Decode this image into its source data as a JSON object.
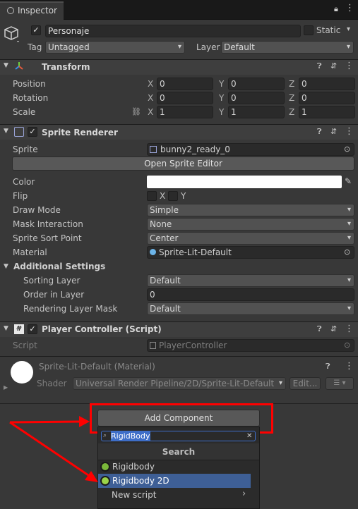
{
  "tab": {
    "title": "Inspector"
  },
  "gameobject": {
    "name": "Personaje",
    "static_label": "Static",
    "tag_label": "Tag",
    "tag_value": "Untagged",
    "layer_label": "Layer",
    "layer_value": "Default"
  },
  "transform": {
    "title": "Transform",
    "position_label": "Position",
    "rotation_label": "Rotation",
    "scale_label": "Scale",
    "x": "X",
    "y": "Y",
    "z": "Z",
    "position": [
      "0",
      "0",
      "0"
    ],
    "rotation": [
      "0",
      "0",
      "0"
    ],
    "scale": [
      "1",
      "1",
      "1"
    ]
  },
  "sprite_renderer": {
    "title": "Sprite Renderer",
    "sprite_label": "Sprite",
    "sprite_value": "bunny2_ready_0",
    "open_editor": "Open Sprite Editor",
    "color_label": "Color",
    "flip_label": "Flip",
    "flip_x": "X",
    "flip_y": "Y",
    "draw_mode_label": "Draw Mode",
    "draw_mode": "Simple",
    "mask_label": "Mask Interaction",
    "mask": "None",
    "sort_point_label": "Sprite Sort Point",
    "sort_point": "Center",
    "material_label": "Material",
    "material": "Sprite-Lit-Default",
    "additional_label": "Additional Settings",
    "sorting_layer_label": "Sorting Layer",
    "sorting_layer": "Default",
    "order_label": "Order in Layer",
    "order": "0",
    "rlm_label": "Rendering Layer Mask",
    "rlm": "Default"
  },
  "player_controller": {
    "title": "Player Controller (Script)",
    "script_label": "Script",
    "script_value": "PlayerController"
  },
  "material": {
    "title": "Sprite-Lit-Default (Material)",
    "shader_label": "Shader",
    "shader_value": "Universal Render Pipeline/2D/Sprite-Lit-Default",
    "edit_label": "Edit..."
  },
  "add_component": {
    "label": "Add Component"
  },
  "popup": {
    "search_value": "RigidBody",
    "search_header": "Search",
    "items": [
      "Rigidbody",
      "Rigidbody 2D",
      "New script"
    ]
  },
  "colors": {
    "highlight": "#3e5f96",
    "annotation": "#ff0000",
    "background": "#383838"
  }
}
